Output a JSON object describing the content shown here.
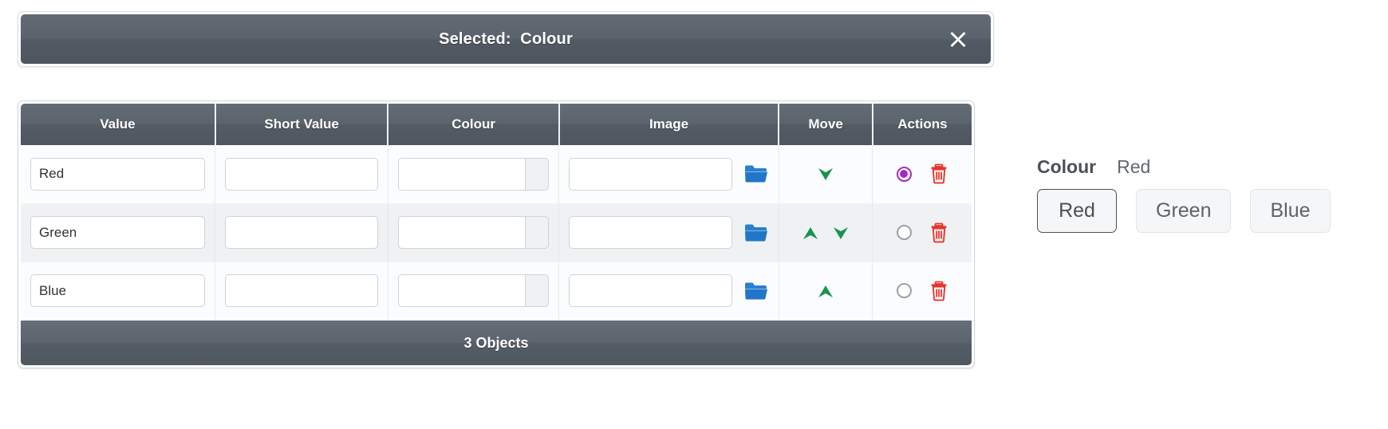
{
  "banner": {
    "title": "Selected:  Colour",
    "close_icon": "close-x-icon"
  },
  "table": {
    "columns": [
      "Value",
      "Short Value",
      "Colour",
      "Image",
      "Move",
      "Actions"
    ],
    "rows": [
      {
        "value": "Red",
        "short_value": "",
        "colour": "",
        "image": "",
        "move": [
          "down"
        ],
        "selected": true
      },
      {
        "value": "Green",
        "short_value": "",
        "colour": "",
        "image": "",
        "move": [
          "up",
          "down"
        ],
        "selected": false
      },
      {
        "value": "Blue",
        "short_value": "",
        "colour": "",
        "image": "",
        "move": [
          "up"
        ],
        "selected": false
      }
    ],
    "footer": "3 Objects",
    "icons": {
      "folder": "folder-open-icon",
      "move_up": "arrow-up-icon",
      "move_down": "arrow-down-icon",
      "delete": "trash-icon",
      "select": "radio-select-icon"
    }
  },
  "panel": {
    "label": "Colour",
    "value": "Red",
    "options": [
      "Red",
      "Green",
      "Blue"
    ],
    "selected_index": 0
  },
  "colors": {
    "header_bar": "#545c66",
    "accent_radio": "#a12bbd",
    "trash_red": "#e8352c",
    "folder_blue": "#2176c7",
    "arrow_green": "#1a9251"
  }
}
